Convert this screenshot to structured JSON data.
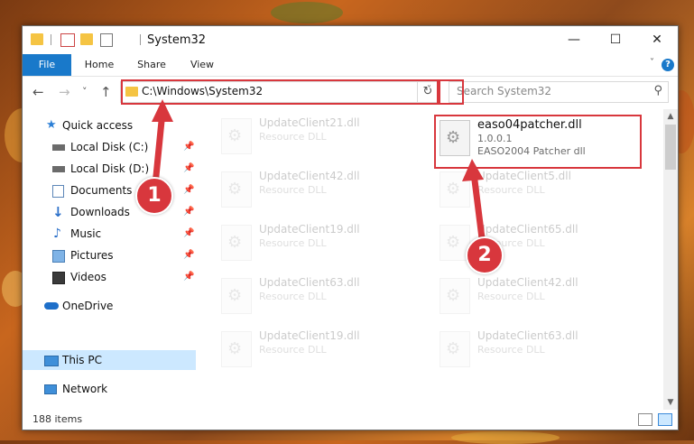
{
  "window": {
    "title": "System32",
    "minimize": "—",
    "maximize": "☐",
    "close": "✕"
  },
  "ribbon": {
    "tabs": [
      "File",
      "Home",
      "Share",
      "View"
    ],
    "help": "?",
    "collapse": "˅"
  },
  "nav": {
    "back": "←",
    "forward": "→",
    "recent": "˅",
    "up": "↑",
    "address": "C:\\Windows\\System32",
    "address_dropdown": "˅",
    "refresh": "↻",
    "search_placeholder": "Search System32",
    "search_icon": "⚲"
  },
  "sidebar": {
    "items": [
      {
        "label": "Quick access",
        "icon": "star-icon",
        "pinned": false
      },
      {
        "label": "Local Disk (C:)",
        "icon": "drive-icon",
        "pinned": true
      },
      {
        "label": "Local Disk (D:)",
        "icon": "drive-icon",
        "pinned": true
      },
      {
        "label": "Documents",
        "icon": "documents-icon",
        "pinned": true
      },
      {
        "label": "Downloads",
        "icon": "download-icon",
        "pinned": true
      },
      {
        "label": "Music",
        "icon": "music-icon",
        "pinned": true
      },
      {
        "label": "Pictures",
        "icon": "pictures-icon",
        "pinned": true
      },
      {
        "label": "Videos",
        "icon": "videos-icon",
        "pinned": true
      },
      {
        "label": "OneDrive",
        "icon": "cloud-icon",
        "pinned": false
      },
      {
        "label": "This PC",
        "icon": "computer-icon",
        "pinned": false
      },
      {
        "label": "Network",
        "icon": "network-icon",
        "pinned": false
      }
    ],
    "pin_glyph": "📌"
  },
  "files": {
    "left_column": [
      {
        "name": "UpdateClient21.dll",
        "type": "Resource DLL"
      },
      {
        "name": "UpdateClient42.dll",
        "type": "Resource DLL"
      },
      {
        "name": "UpdateClient19.dll",
        "type": "Resource DLL"
      },
      {
        "name": "UpdateClient63.dll",
        "type": "Resource DLL"
      },
      {
        "name": "UpdateClient19.dll",
        "type": "Resource DLL"
      }
    ],
    "right_column": [
      {
        "name": "easo04patcher.dll",
        "version": "1.0.0.1",
        "type": "EASO2004 Patcher dll"
      },
      {
        "name": "UpdateClient5.dll",
        "type": "Resource DLL"
      },
      {
        "name": "UpdateClient65.dll",
        "type": "Resource DLL"
      },
      {
        "name": "UpdateClient42.dll",
        "type": "Resource DLL"
      },
      {
        "name": "UpdateClient63.dll",
        "type": "Resource DLL"
      }
    ]
  },
  "status": {
    "item_count": "188 items"
  },
  "annotations": {
    "step1": "1",
    "step2": "2"
  },
  "colors": {
    "accent": "#1979ca",
    "highlight": "#d8373d",
    "selection": "#cce8ff"
  }
}
